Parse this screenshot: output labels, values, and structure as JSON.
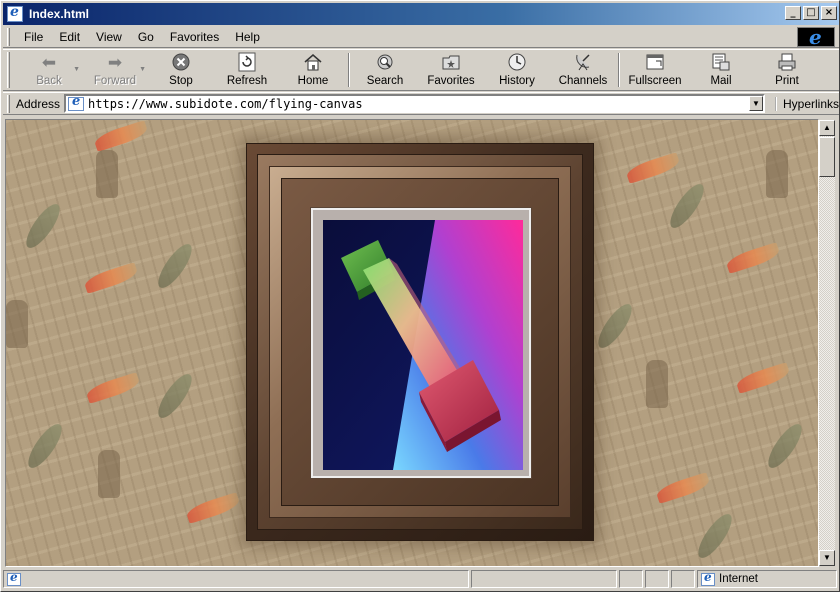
{
  "window": {
    "title": "Index.html",
    "controls": [
      "minimize",
      "maximize",
      "close"
    ]
  },
  "menu": {
    "items": [
      {
        "label": "File"
      },
      {
        "label": "Edit"
      },
      {
        "label": "View"
      },
      {
        "label": "Go"
      },
      {
        "label": "Favorites"
      },
      {
        "label": "Help"
      }
    ]
  },
  "toolbar": {
    "buttons": [
      {
        "label": "Back",
        "icon": "back-arrow-icon",
        "enabled": false
      },
      {
        "label": "Forward",
        "icon": "forward-arrow-icon",
        "enabled": false
      },
      {
        "label": "Stop",
        "icon": "stop-icon",
        "enabled": true
      },
      {
        "label": "Refresh",
        "icon": "refresh-icon",
        "enabled": true
      },
      {
        "label": "Home",
        "icon": "home-icon",
        "enabled": true
      },
      {
        "label": "Search",
        "icon": "search-icon",
        "enabled": true
      },
      {
        "label": "Favorites",
        "icon": "favorites-icon",
        "enabled": true
      },
      {
        "label": "History",
        "icon": "history-icon",
        "enabled": true
      },
      {
        "label": "Channels",
        "icon": "channels-icon",
        "enabled": true
      },
      {
        "label": "Fullscreen",
        "icon": "fullscreen-icon",
        "enabled": true
      },
      {
        "label": "Mail",
        "icon": "mail-icon",
        "enabled": true
      },
      {
        "label": "Print",
        "icon": "print-icon",
        "enabled": true
      }
    ]
  },
  "address": {
    "label": "Address",
    "url": "https://www.subidote.com/flying-canvas",
    "links_label": "Hyperlinks"
  },
  "status": {
    "text": "",
    "zone": "Internet"
  },
  "colors": {
    "title_start": "#0a246a",
    "title_end": "#a6caf0",
    "chrome": "#d4d0c8",
    "wallpaper": "#b39f80",
    "frame_dark": "#2a1c13",
    "art_background": "#0c1250"
  }
}
